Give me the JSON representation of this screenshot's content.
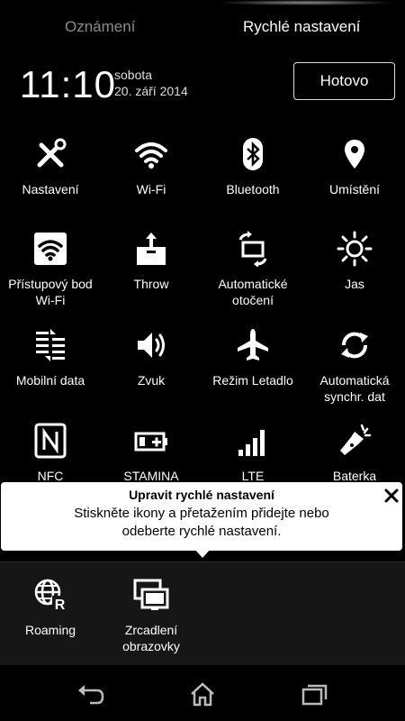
{
  "tabs": {
    "notifications": "Oznámení",
    "quick_settings": "Rychlé nastavení"
  },
  "status": {
    "time": "11:10",
    "day": "sobota",
    "date": "20. září 2014"
  },
  "done_button": "Hotovo",
  "tiles": [
    {
      "label": "Nastavení",
      "icon": "settings-tools-icon"
    },
    {
      "label": "Wi-Fi",
      "icon": "wifi-icon"
    },
    {
      "label": "Bluetooth",
      "icon": "bluetooth-icon"
    },
    {
      "label": "Umístění",
      "icon": "location-pin-icon"
    },
    {
      "label": "Přístupový bod Wi-Fi",
      "icon": "wifi-hotspot-icon"
    },
    {
      "label": "Throw",
      "icon": "throw-icon"
    },
    {
      "label": "Automatické otočení",
      "icon": "auto-rotate-icon"
    },
    {
      "label": "Jas",
      "icon": "brightness-icon"
    },
    {
      "label": "Mobilní data",
      "icon": "mobile-data-icon"
    },
    {
      "label": "Zvuk",
      "icon": "sound-icon"
    },
    {
      "label": "Režim Letadlo",
      "icon": "airplane-icon"
    },
    {
      "label": "Automatická synchr. dat",
      "icon": "sync-icon"
    },
    {
      "label": "NFC",
      "icon": "nfc-icon"
    },
    {
      "label": "STAMINA",
      "icon": "battery-stamina-icon"
    },
    {
      "label": "LTE",
      "icon": "signal-bars-icon"
    },
    {
      "label": "Baterka",
      "icon": "flashlight-icon"
    }
  ],
  "tooltip": {
    "title": "Upravit rychlé nastavení",
    "body": "Stiskněte ikony a přetažením přidejte nebo odeberte rychlé nastavení."
  },
  "tray": [
    {
      "label": "Roaming",
      "icon": "roaming-globe-icon"
    },
    {
      "label": "Zrcadlení obrazovky",
      "icon": "screen-mirroring-icon"
    }
  ],
  "navbar": {
    "back": "back-icon",
    "home": "home-icon",
    "recents": "recents-icon"
  }
}
